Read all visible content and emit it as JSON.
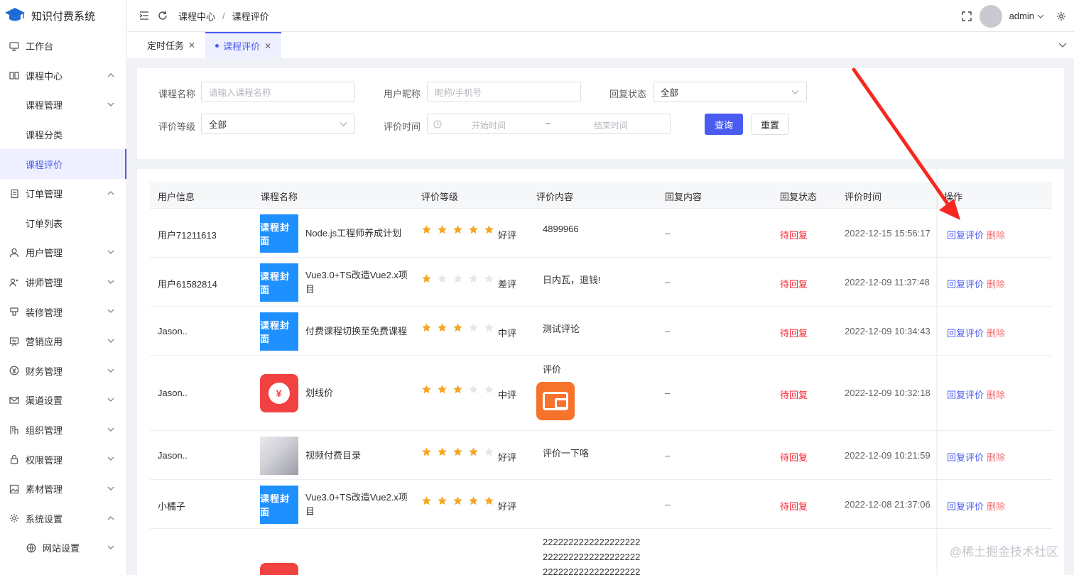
{
  "app": {
    "title": "知识付费系统"
  },
  "sidebar": {
    "items": [
      {
        "label": "工作台",
        "icon": "monitor-icon",
        "level": 0,
        "chevron": ""
      },
      {
        "label": "课程中心",
        "icon": "book-icon",
        "level": 0,
        "chevron": "up"
      },
      {
        "label": "课程管理",
        "icon": "",
        "level": 1,
        "chevron": "down"
      },
      {
        "label": "课程分类",
        "icon": "",
        "level": 1,
        "chevron": ""
      },
      {
        "label": "课程评价",
        "icon": "",
        "level": 1,
        "chevron": "",
        "active": true
      },
      {
        "label": "订单管理",
        "icon": "order-icon",
        "level": 0,
        "chevron": "up"
      },
      {
        "label": "订单列表",
        "icon": "",
        "level": 1,
        "chevron": ""
      },
      {
        "label": "用户管理",
        "icon": "user-icon",
        "level": 0,
        "chevron": "down"
      },
      {
        "label": "讲师管理",
        "icon": "teacher-icon",
        "level": 0,
        "chevron": "down"
      },
      {
        "label": "装修管理",
        "icon": "decor-icon",
        "level": 0,
        "chevron": "down"
      },
      {
        "label": "营销应用",
        "icon": "marketing-icon",
        "level": 0,
        "chevron": "down"
      },
      {
        "label": "财务管理",
        "icon": "yen-icon",
        "level": 0,
        "chevron": "down"
      },
      {
        "label": "渠道设置",
        "icon": "mail-icon",
        "level": 0,
        "chevron": "down"
      },
      {
        "label": "组织管理",
        "icon": "org-icon",
        "level": 0,
        "chevron": "down"
      },
      {
        "label": "权限管理",
        "icon": "lock-icon",
        "level": 0,
        "chevron": "down"
      },
      {
        "label": "素材管理",
        "icon": "image-icon",
        "level": 0,
        "chevron": "down"
      },
      {
        "label": "系统设置",
        "icon": "gear-icon",
        "level": 0,
        "chevron": "up"
      },
      {
        "label": "网站设置",
        "icon": "globe-icon",
        "level": 1,
        "chevron": "down"
      }
    ]
  },
  "header": {
    "breadcrumb": [
      "课程中心",
      "/",
      "课程评价"
    ],
    "username": "admin"
  },
  "tabs": [
    {
      "label": "定时任务",
      "active": false
    },
    {
      "label": "课程评价",
      "active": true
    }
  ],
  "filter": {
    "course_name_label": "课程名称",
    "course_name_placeholder": "请输入课程名称",
    "nickname_label": "用户昵称",
    "nickname_placeholder": "昵称/手机号",
    "reply_status_label": "回复状态",
    "reply_status_value": "全部",
    "rating_label": "评价等级",
    "rating_value": "全部",
    "time_label": "评价时间",
    "start_placeholder": "开始时间",
    "range_sep": "–",
    "end_placeholder": "结束时间",
    "search_button": "查询",
    "reset_button": "重置"
  },
  "table": {
    "columns": [
      "用户信息",
      "课程名称",
      "评价等级",
      "评价内容",
      "回复内容",
      "回复状态",
      "评价时间",
      "操作"
    ],
    "rows": [
      {
        "user": "用户71211613",
        "cover": "课程封面",
        "cover_type": "blue",
        "course": "Node.js工程师养成计划",
        "stars": 5,
        "grade": "好评",
        "content": "4899966",
        "reply": "–",
        "status": "待回复",
        "time": "2022-12-15 15:56:17",
        "op_reply": "回复评价",
        "op_delete": "删除"
      },
      {
        "user": "用户61582814",
        "cover": "课程封面",
        "cover_type": "blue",
        "course": "Vue3.0+TS改造Vue2.x项目",
        "stars": 1,
        "grade": "差评",
        "content": "日内瓦，退钱!",
        "reply": "–",
        "status": "待回复",
        "time": "2022-12-09 11:37:48",
        "op_reply": "回复评价",
        "op_delete": "删除"
      },
      {
        "user": "Jason..",
        "cover": "课程封面",
        "cover_type": "blue",
        "course": "付费课程切换至免费课程",
        "stars": 3,
        "grade": "中评",
        "content": "测试评论",
        "reply": "–",
        "status": "待回复",
        "time": "2022-12-09 10:34:43",
        "op_reply": "回复评价",
        "op_delete": "删除"
      },
      {
        "user": "Jason..",
        "cover": "¥",
        "cover_type": "red",
        "course": "划线价",
        "stars": 3,
        "grade": "中评",
        "content": "评价",
        "reply": "–",
        "status": "待回复",
        "time": "2022-12-09 10:32:18",
        "op_reply": "回复评价",
        "op_delete": "删除",
        "content_image": "wallet-icon"
      },
      {
        "user": "Jason..",
        "cover": "",
        "cover_type": "pic",
        "course": "视频付费目录",
        "stars": 4,
        "grade": "好评",
        "content": "评价一下咯",
        "reply": "–",
        "status": "待回复",
        "time": "2022-12-09 10:21:59",
        "op_reply": "回复评价",
        "op_delete": "删除"
      },
      {
        "user": "小橘子",
        "cover": "课程封面",
        "cover_type": "blue",
        "course": "Vue3.0+TS改造Vue2.x项目",
        "stars": 5,
        "grade": "好评",
        "content": "",
        "reply": "–",
        "status": "待回复",
        "time": "2022-12-08 21:37:06",
        "op_reply": "回复评价",
        "op_delete": "删除"
      }
    ],
    "partial_row_content": [
      "2222222222222222222",
      "2222222222222222222",
      "2222222222222222222"
    ]
  },
  "watermark": "@稀土掘金技术社区",
  "colors": {
    "accent": "#4a5cf0",
    "danger": "#f5222d",
    "star": "#f5a623",
    "annotation_arrow": "#f5291f"
  }
}
